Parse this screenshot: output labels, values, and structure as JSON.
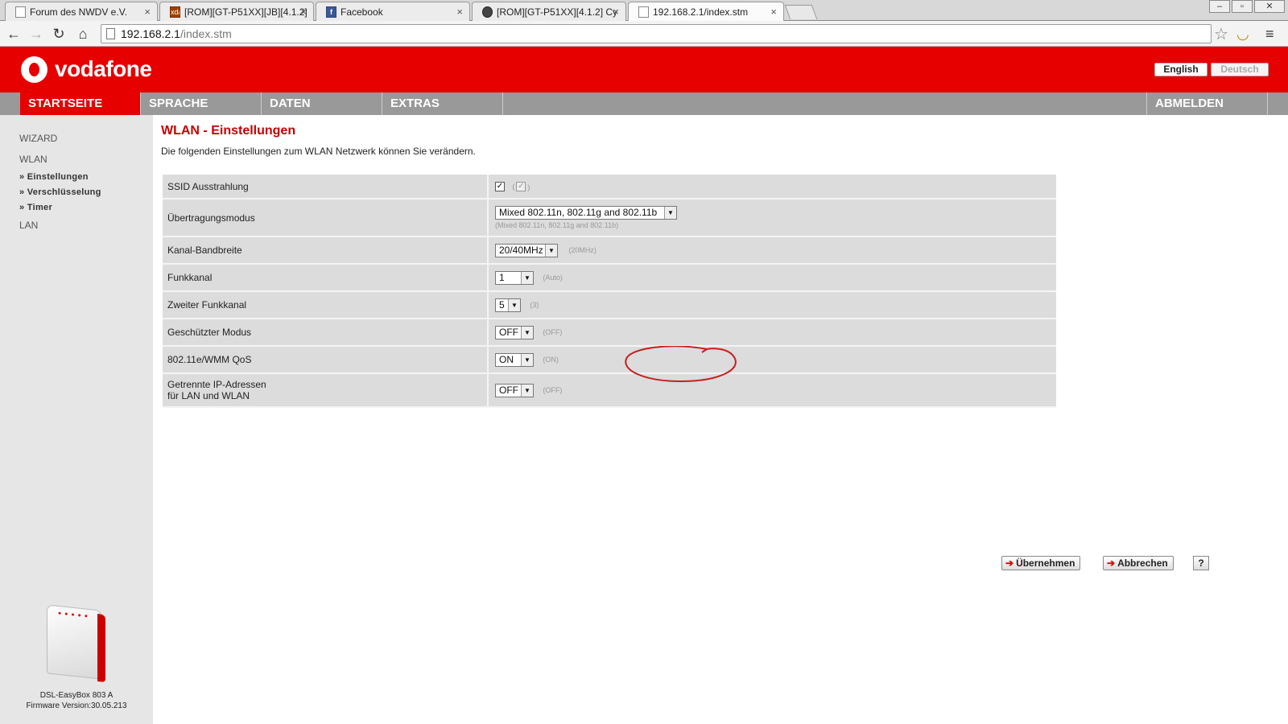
{
  "browser": {
    "tabs": [
      {
        "title": "Forum des NWDV e.V.",
        "icon": "page-icon"
      },
      {
        "title": "[ROM][GT-P51XX][JB][4.1.2]",
        "icon": "xda-icon"
      },
      {
        "title": "Facebook",
        "icon": "facebook-icon"
      },
      {
        "title": "[ROM][GT-P51XX][4.1.2] Cy",
        "icon": "android-icon"
      },
      {
        "title": "192.168.2.1/index.stm",
        "icon": "page-icon"
      }
    ],
    "url_host": "192.168.2.1",
    "url_path": "/index.stm"
  },
  "header": {
    "logo_text": "vodafone",
    "lang_english": "English",
    "lang_deutsch": "Deutsch"
  },
  "menu": {
    "startseite": "STARTSEITE",
    "sprache": "SPRACHE",
    "daten": "DATEN",
    "extras": "EXTRAS",
    "abmelden": "ABMELDEN"
  },
  "sidebar": {
    "wizard": "WIZARD",
    "wlan": "WLAN",
    "einstellungen": "» Einstellungen",
    "verschluesselung": "» Verschlüsselung",
    "timer": "» Timer",
    "lan": "LAN",
    "device_name": "DSL-EasyBox 803 A",
    "firmware": "Firmware Version:30.05.213"
  },
  "page": {
    "title": "WLAN - Einstellungen",
    "description": "Die folgenden Einstellungen zum WLAN Netzwerk können Sie verändern."
  },
  "settings": {
    "ssid": {
      "label": "SSID Ausstrahlung",
      "default_open": "(",
      "default_close": ")"
    },
    "mode": {
      "label": "Übertragungsmodus",
      "value": "Mixed 802.11n, 802.11g and 802.11b",
      "default": "(Mixed 802.11n, 802.11g and 802.11b)"
    },
    "bandwidth": {
      "label": "Kanal-Bandbreite",
      "value": "20/40MHz",
      "default": "(20MHz)"
    },
    "channel": {
      "label": "Funkkanal",
      "value": "1",
      "default": "(Auto)"
    },
    "channel2": {
      "label": "Zweiter Funkkanal",
      "value": "5",
      "default": "(3)"
    },
    "protected": {
      "label": "Geschützter Modus",
      "value": "OFF",
      "default": "(OFF)"
    },
    "qos": {
      "label": "802.11e/WMM QoS",
      "value": "ON",
      "default": "(ON)"
    },
    "separate": {
      "label_1": "Getrennte IP-Adressen",
      "label_2": "für LAN und WLAN",
      "value": "OFF",
      "default": "(OFF)"
    }
  },
  "buttons": {
    "apply": "Übernehmen",
    "cancel": "Abbrechen",
    "help": "?"
  },
  "colors": {
    "brand_red": "#e60000",
    "menu_grey": "#999999",
    "sidebar_grey": "#e6e6e6"
  }
}
